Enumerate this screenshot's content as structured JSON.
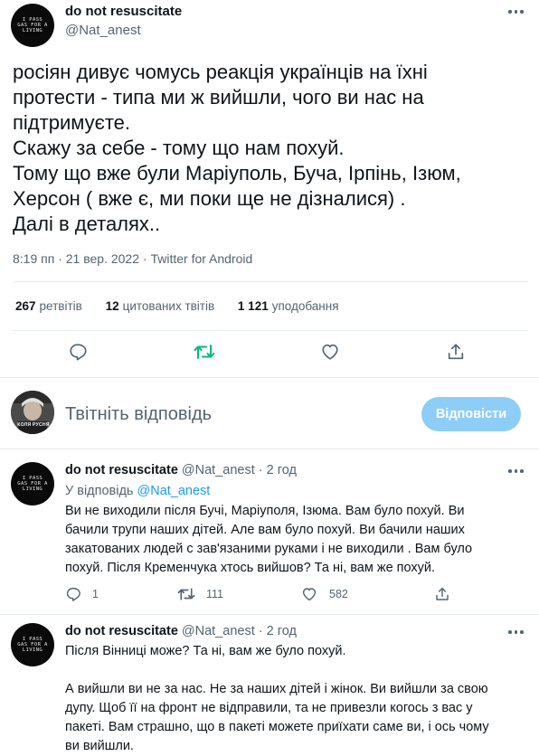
{
  "main_tweet": {
    "author_name": "do not resuscitate",
    "author_handle": "@Nat_anest",
    "avatar_text": "I PASS GAS FOR A LIVING",
    "text_lines": [
      "росіян дивує чомусь реакція українців на їхні",
      "протести - типа ми ж вийшли, чого ви нас на",
      "підтримуєте.",
      "Скажу за себе - тому що нам похуй.",
      "Тому що вже були Маріуполь, Буча, Ірпінь, Ізюм,",
      "Херсон ( вже є, ми поки ще не дізналися) .",
      "Далі в деталях.."
    ],
    "time": "8:19 пп",
    "date": "21 вер. 2022",
    "source": "Twitter for Android",
    "separator": "·",
    "stats": {
      "retweets_count": "267",
      "retweets_label": "ретвітів",
      "quotes_count": "12",
      "quotes_label": "цитованих твітів",
      "likes_count": "1 121",
      "likes_label": "уподобання"
    }
  },
  "actions": {
    "reply_icon": "reply-icon",
    "retweet_icon": "retweet-icon",
    "like_icon": "heart-icon",
    "share_icon": "share-icon",
    "retweet_color": "#00ba7c"
  },
  "compose": {
    "avatar_caption": "КОЛЯ РУСНЯ",
    "placeholder": "Твітніть відповідь",
    "button_label": "Відповісти",
    "button_color": "#8ecdf8"
  },
  "replies": [
    {
      "author_name": "do not resuscitate",
      "author_handle": "@Nat_anest",
      "separator": "·",
      "time": "2 год",
      "replying_label": "У відповідь",
      "replying_handle": "@Nat_anest",
      "text_lines": [
        "Ви не виходили після Бучі, Маріуполя, Ізюма. Вам було похуй. Ви",
        "бачили трупи наших дітей. Але вам було похуй. Ви бачили наших",
        "закатованих людей с зав'язаними руками і не виходили . Вам було",
        "похуй. Після Кременчука хтось вийшов? Та ні, вам же похуй."
      ],
      "reply_count": "1",
      "retweet_count": "111",
      "like_count": "582"
    },
    {
      "author_name": "do not resuscitate",
      "author_handle": "@Nat_anest",
      "separator": "·",
      "time": "2 год",
      "text_lines": [
        "Після Вінниці може? Та ні, вам же було похуй.",
        "",
        "А вийшли ви не за нас. Не за наших дітей і жінок. Ви вийшли за свою",
        "дупу. Щоб її на фронт не відправили, та не привезли когось з вас у",
        "пакеті. Вам страшно, що в пакеті можете приїхати саме ви, і ось чому",
        "ви вийшли."
      ]
    }
  ]
}
